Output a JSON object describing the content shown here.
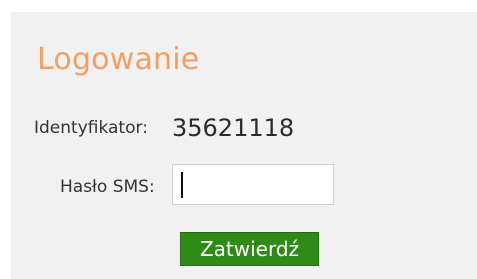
{
  "login": {
    "title": "Logowanie",
    "identifier_label": "Identyfikator:",
    "identifier_value": "35621118",
    "sms_label": "Hasło SMS:",
    "sms_value": "",
    "submit_label": "Zatwierdź"
  },
  "colors": {
    "title": "#f0a064",
    "panel_background": "#f1f1f1",
    "submit_background": "#2f8a17",
    "submit_text": "#ffffff"
  }
}
